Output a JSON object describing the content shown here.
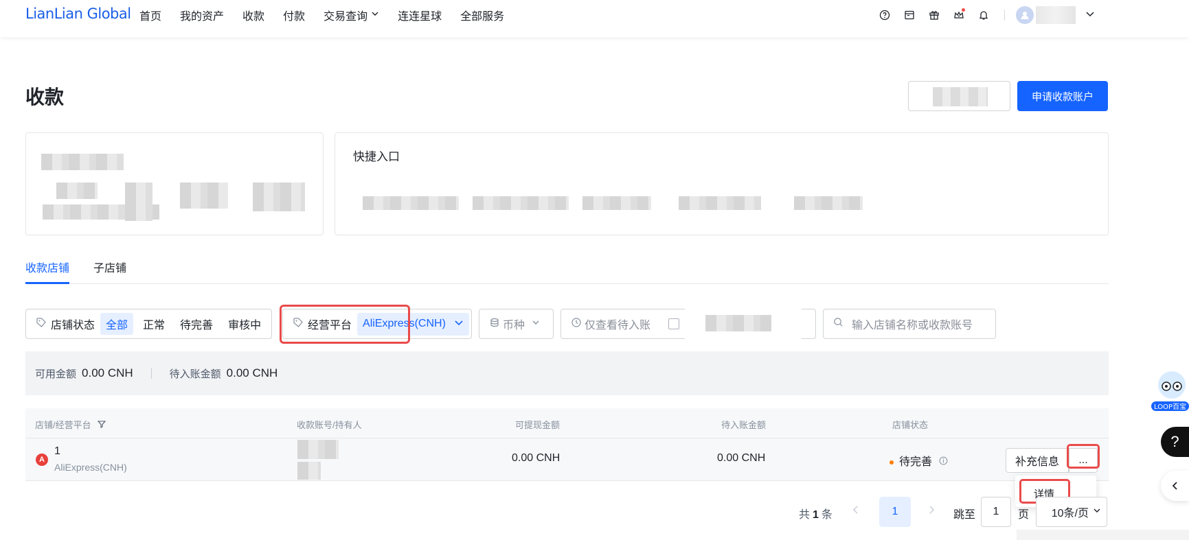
{
  "header": {
    "logo": "LianLian Global",
    "nav": [
      {
        "label": "首页"
      },
      {
        "label": "我的资产"
      },
      {
        "label": "收款"
      },
      {
        "label": "付款"
      },
      {
        "label": "交易查询",
        "dropdown": true
      },
      {
        "label": "连连星球"
      },
      {
        "label": "全部服务"
      }
    ],
    "icons": [
      "help-icon",
      "calendar-icon",
      "gift-icon",
      "crown-icon",
      "bell-icon"
    ]
  },
  "page": {
    "title": "收款",
    "apply_button": "申请收款账户"
  },
  "quick_entry": {
    "title": "快捷入口"
  },
  "tabs": [
    {
      "label": "收款店铺",
      "active": true
    },
    {
      "label": "子店铺",
      "active": false
    }
  ],
  "filters": {
    "status": {
      "label": "店铺状态",
      "options": [
        "全部",
        "正常",
        "待完善",
        "审核中"
      ],
      "selected": "全部"
    },
    "platform": {
      "label": "经营平台",
      "value": "AliExpress(CNH)"
    },
    "currency": {
      "label": "币种"
    },
    "pending": {
      "label": "仅查看待入账"
    },
    "search": {
      "placeholder": "输入店铺名称或收款账号"
    }
  },
  "summary": {
    "available_label": "可用金额",
    "available_value": "0.00 CNH",
    "pending_label": "待入账金额",
    "pending_value": "0.00 CNH"
  },
  "table": {
    "columns": [
      "店铺/经营平台",
      "收款账号/持有人",
      "可提现金额",
      "待入账金额",
      "店铺状态"
    ],
    "rows": [
      {
        "badge": "A",
        "shop": "1",
        "platform": "AliExpress(CNH)",
        "withdrawable": "0.00 CNH",
        "pending": "0.00 CNH",
        "status": "待完善",
        "action": "补充信息",
        "more": "..."
      }
    ]
  },
  "dropdown": {
    "item": "详情"
  },
  "pagination": {
    "total_prefix": "共",
    "total": "1",
    "total_suffix": "条",
    "current": "1",
    "jump_label": "跳至",
    "jump_value": "1",
    "page_suffix": "页",
    "page_size": "10条/页"
  },
  "widgets": {
    "loop_label": "LOOP百宝",
    "help": "?"
  },
  "colors": {
    "primary": "#1664ff",
    "highlight": "#e94b4b",
    "warning": "#ff7d00",
    "badge": "#e8413b"
  }
}
